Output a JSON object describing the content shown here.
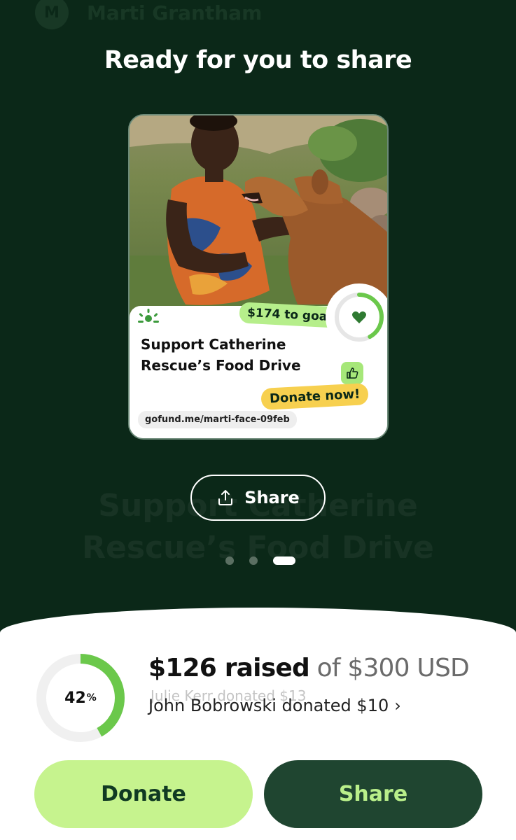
{
  "header": {
    "avatar_initial": "M",
    "user_name": "Marti Grantham"
  },
  "share_screen": {
    "headline": "Ready for you to share",
    "card": {
      "to_goal": "$174 to goal",
      "title_line1": "Support Catherine",
      "title_line2": "Rescue’s Food Drive",
      "donate_now": "Donate now!",
      "url": "gofund.me/marti-face-09feb"
    },
    "share_button": "Share",
    "background_title_line1": "Support Catherine",
    "background_title_line2": "Rescue’s Food Drive",
    "carousel": {
      "count": 3,
      "active_index": 2
    }
  },
  "summary": {
    "percent": "42",
    "percent_sign": "%",
    "progress_fraction": 0.42,
    "raised_amount": "$126 raised",
    "raised_of": "of $300 USD",
    "ghost_donation": "Julie Kerr donated $13",
    "latest_donation": "John Bobrowski donated $10",
    "donate_label": "Donate",
    "share_label": "Share"
  },
  "colors": {
    "background": "#0b2818",
    "accent_green": "#c6f38e",
    "dark_green": "#1f4530",
    "progress": "#6bc84b",
    "badge_yellow": "#f7d04f"
  },
  "icons": {
    "share": "share-upload-icon",
    "heart": "heart-icon",
    "thumbs_up": "thumbs-up-icon",
    "brand": "gofundme-icon",
    "chevron": "chevron-right-icon"
  }
}
